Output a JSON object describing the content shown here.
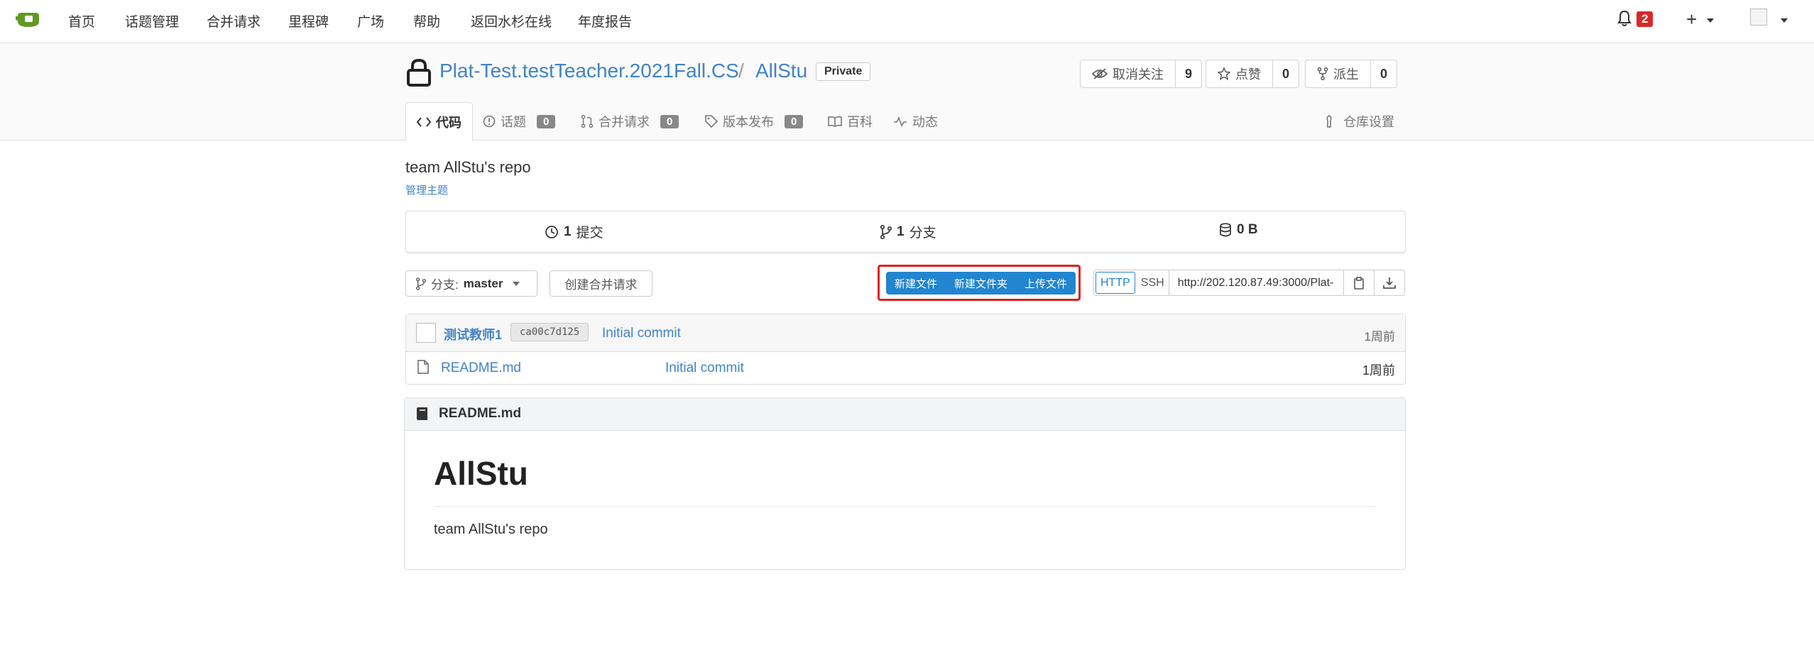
{
  "nav": {
    "items": [
      "首页",
      "话题管理",
      "合并请求",
      "里程碑",
      "广场",
      "帮助",
      "返回水杉在线",
      "年度报告"
    ],
    "notification_count": "2",
    "plus": "+"
  },
  "repo": {
    "owner": "Plat-Test.testTeacher.2021Fall.CS",
    "separator": "/",
    "name": "AllStu",
    "visibility": "Private",
    "watch": {
      "label": "取消关注",
      "count": "9"
    },
    "star": {
      "label": "点赞",
      "count": "0"
    },
    "fork": {
      "label": "派生",
      "count": "0"
    }
  },
  "tabs": {
    "code": "代码",
    "issues": {
      "label": "话题",
      "count": "0"
    },
    "pulls": {
      "label": "合并请求",
      "count": "0"
    },
    "releases": {
      "label": "版本发布",
      "count": "0"
    },
    "wiki": "百科",
    "activity": "动态",
    "settings": "仓库设置"
  },
  "description": "team AllStu's repo",
  "manage_topics": "管理主题",
  "stats": {
    "commits": {
      "count": "1",
      "label": "提交"
    },
    "branches": {
      "count": "1",
      "label": "分支"
    },
    "size": "0 B"
  },
  "branch": {
    "prefix": "分支:",
    "name": "master"
  },
  "create_pr": "创建合并请求",
  "file_actions": [
    "新建文件",
    "新建文件夹",
    "上传文件"
  ],
  "clone": {
    "http": "HTTP",
    "ssh": "SSH",
    "url": "http://202.120.87.49:3000/Plat-"
  },
  "latest_commit": {
    "author": "测试教师1",
    "sha": "ca00c7d125",
    "message": "Initial commit",
    "time": "1周前"
  },
  "files": [
    {
      "name": "README.md",
      "message": "Initial commit",
      "time": "1周前"
    }
  ],
  "readme": {
    "filename": "README.md",
    "heading": "AllStu",
    "body": "team AllStu's repo"
  },
  "colors": {
    "accent": "#2185d0",
    "link": "#4183c4",
    "highlight": "#e02020",
    "badge": "#db2828"
  }
}
